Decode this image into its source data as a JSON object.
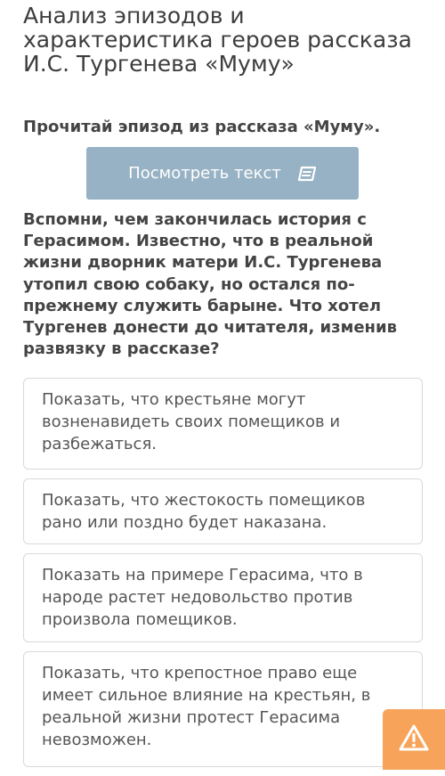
{
  "header": {
    "title": "Анализ эпизодов и характеристика героев рассказа И.С. Тургенева «Муму»"
  },
  "task": {
    "subtitle": "Прочитай эпизод из рассказа «Муму».",
    "view_text_label": "Посмотреть текст",
    "view_text_icon": "book-icon",
    "question": "Вспомни, чем закончилась история с Герасимом. Известно, что в реальной жизни дворник матери И.С. Тургенева утопил свою собаку, но остался по-прежнему служить барыне. Что хотел Тургенев донести до читателя, изменив развязку в рассказе?"
  },
  "options": [
    "Показать, что крестьяне могут возненавидеть своих помещиков и разбежаться.",
    "Показать, что жестокость помещиков рано или поздно будет наказана.",
    "Показать на примере Герасима, что в народе растет недовольство против произвола помещиков.",
    "Показать, что крепостное право еще имеет сильное влияние на крестьян, в реальной жизни протест Герасима невозможен."
  ],
  "report_button": {
    "icon": "warning-icon",
    "color": "#f7a45a"
  },
  "colors": {
    "primary_button": "#96b2c4",
    "text": "#444444",
    "option_border": "#d9d9d9"
  }
}
